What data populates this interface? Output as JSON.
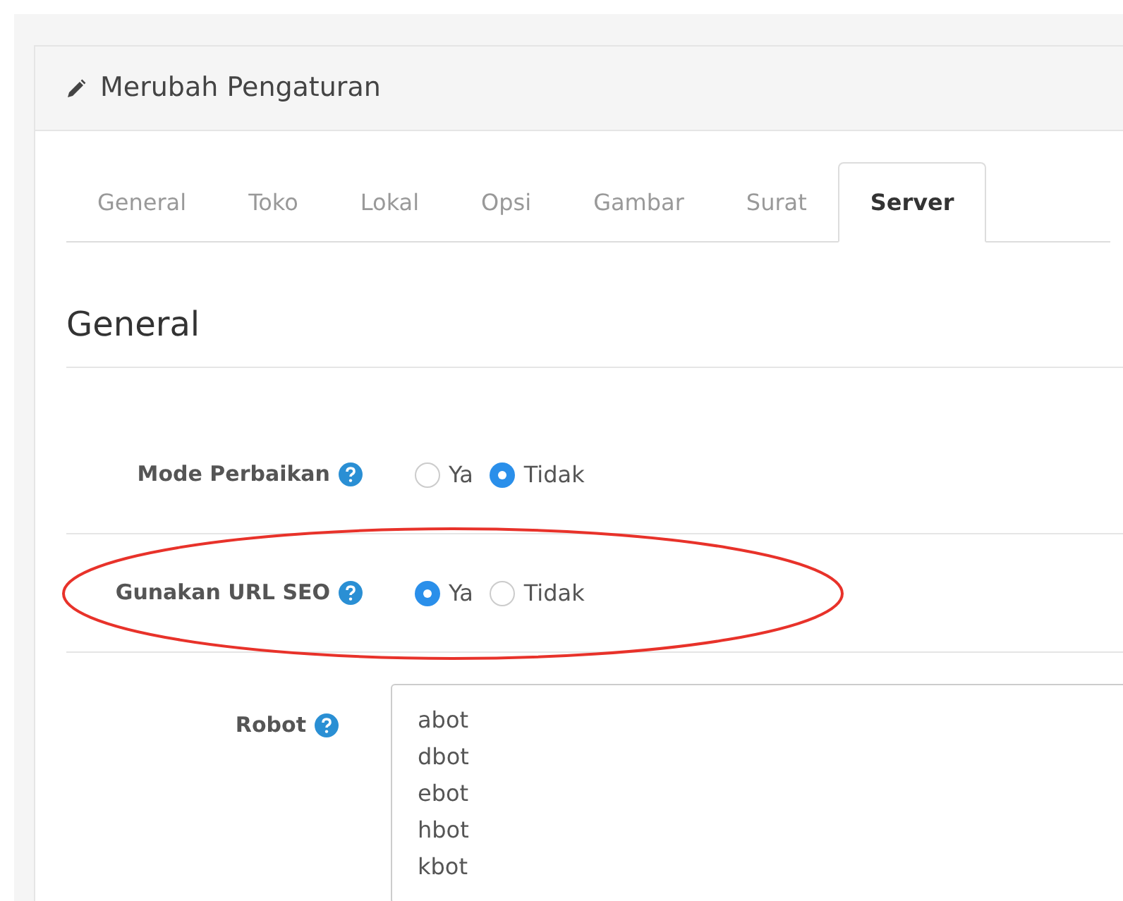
{
  "panel": {
    "title": "Merubah Pengaturan"
  },
  "tabs": [
    {
      "label": "General",
      "selected": false
    },
    {
      "label": "Toko",
      "selected": false
    },
    {
      "label": "Lokal",
      "selected": false
    },
    {
      "label": "Opsi",
      "selected": false
    },
    {
      "label": "Gambar",
      "selected": false
    },
    {
      "label": "Surat",
      "selected": false
    },
    {
      "label": "Server",
      "selected": true
    }
  ],
  "section_title": "General",
  "rows": [
    {
      "kind": "radio",
      "label": "Mode Perbaikan",
      "highlighted": false,
      "options": [
        {
          "label": "Ya",
          "selected": false
        },
        {
          "label": "Tidak",
          "selected": true
        }
      ]
    },
    {
      "kind": "radio",
      "label": "Gunakan URL SEO",
      "highlighted": true,
      "options": [
        {
          "label": "Ya",
          "selected": true
        },
        {
          "label": "Tidak",
          "selected": false
        }
      ]
    },
    {
      "kind": "textarea",
      "label": "Robot",
      "highlighted": false,
      "lines": [
        "abot",
        "dbot",
        "ebot",
        "hbot",
        "kbot"
      ]
    }
  ]
}
